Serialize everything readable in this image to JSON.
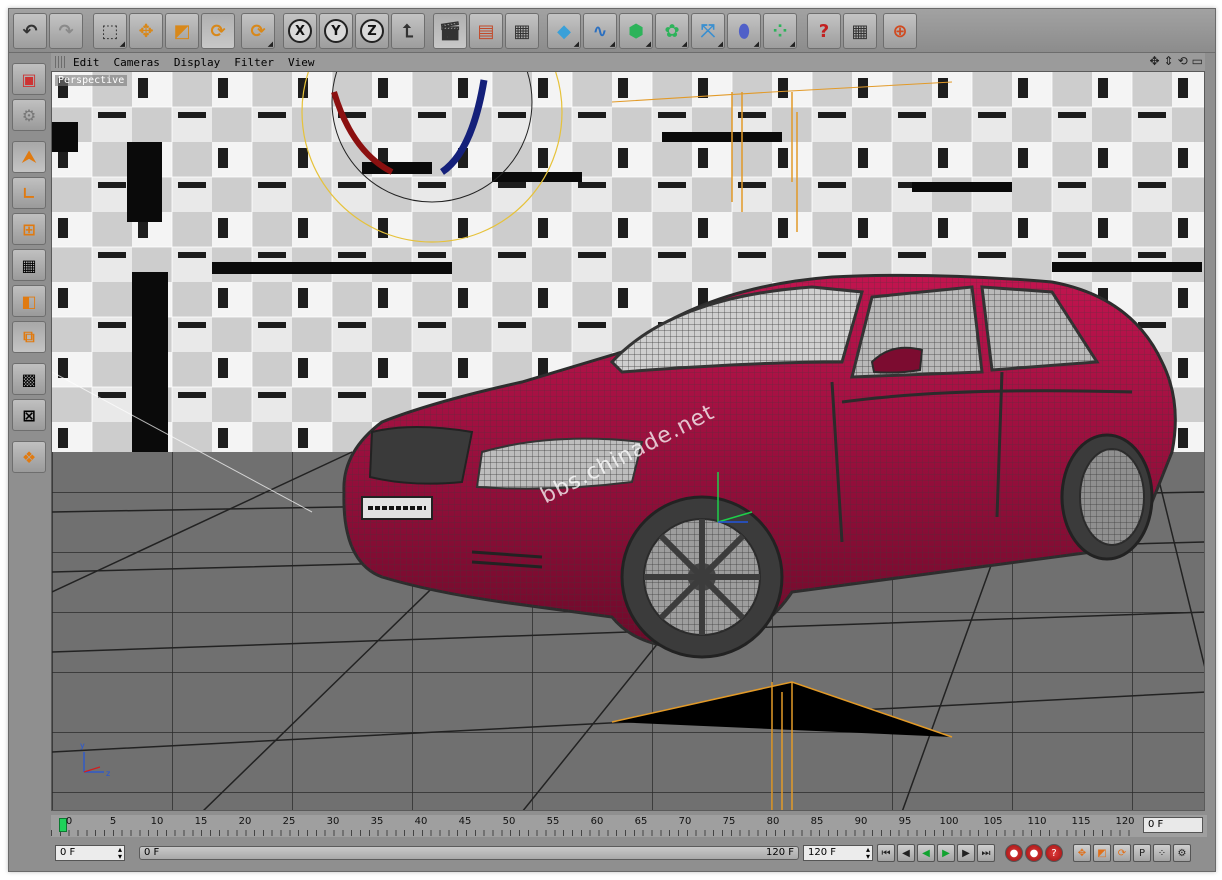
{
  "toolbar": {
    "groups": [
      [
        "undo-icon",
        "redo-icon"
      ],
      [
        "live-selection-icon",
        "move-icon",
        "scale-icon",
        "rotate-icon"
      ],
      [
        "recent-tool-icon"
      ],
      [
        "x-axis-lock-icon",
        "y-axis-lock-icon",
        "z-axis-lock-icon",
        "coordinate-system-icon"
      ],
      [
        "render-view-icon",
        "render-picture-viewer-icon",
        "render-settings-icon"
      ],
      [
        "cube-icon",
        "spline-icon",
        "nurbs-icon",
        "array-icon",
        "deformer-icon",
        "scene-icon",
        "particles-icon"
      ],
      [
        "help-icon",
        "layout-icon"
      ],
      [
        "web-icon"
      ]
    ],
    "axis_labels": {
      "x": "X",
      "y": "Y",
      "z": "Z"
    }
  },
  "palette": [
    "make-editable-icon",
    "use-model-tool-icon",
    "use-object-tool-icon",
    "use-axis-tool-icon",
    "use-points-icon",
    "use-edges-icon",
    "use-polygons-icon",
    "texture-mode-icon",
    "solo-icon",
    "enable-snapping-icon",
    "workplane-icon"
  ],
  "viewport": {
    "menu": [
      "Edit",
      "Cameras",
      "Display",
      "Filter",
      "View"
    ],
    "label": "Perspective",
    "watermark": "bbs.chinade.net",
    "colors": {
      "car_body": "#b0124a",
      "car_wire": "#3c3c3c",
      "floor": "#6f6f6f",
      "wall_light": "#d4d4d4",
      "wall_dark": "#0b0b0b",
      "helper": "#e29a28"
    }
  },
  "timeline": {
    "ticks": [
      "0",
      "5",
      "10",
      "15",
      "20",
      "25",
      "30",
      "35",
      "40",
      "45",
      "50",
      "55",
      "60",
      "65",
      "70",
      "75",
      "80",
      "85",
      "90",
      "95",
      "100",
      "105",
      "110",
      "115",
      "120"
    ],
    "current": "0 F"
  },
  "transport": {
    "start": "0 F",
    "range_start": "0 F",
    "range_end": "120 F",
    "end": "120 F"
  }
}
